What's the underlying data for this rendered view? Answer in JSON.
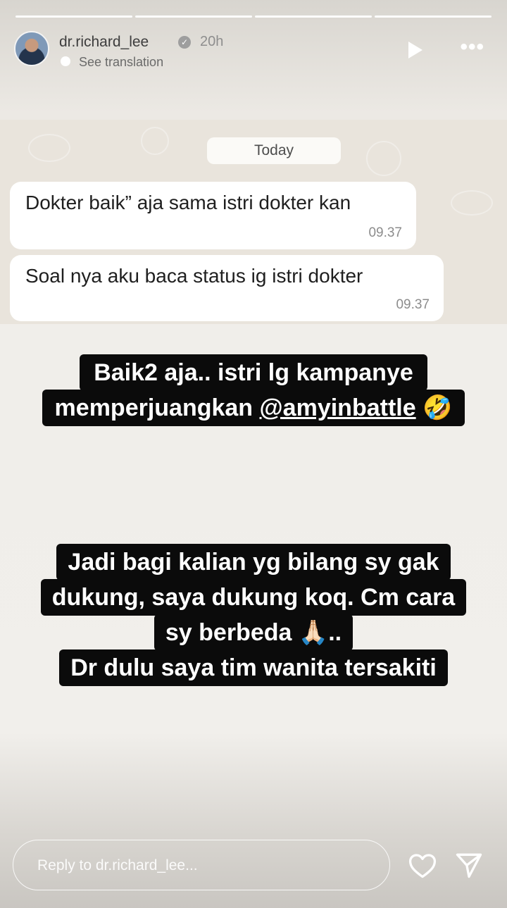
{
  "story": {
    "progress_segments": 4,
    "username": "dr.richard_lee",
    "verified_icon": "verified-badge-icon",
    "time_ago": "20h",
    "see_translation": "See translation"
  },
  "chat": {
    "date_label": "Today",
    "messages": [
      {
        "text": "Dokter baik” aja sama istri dokter kan",
        "time": "09.37"
      },
      {
        "text": "Soal nya aku baca status ig istri dokter",
        "time": "09.37"
      }
    ]
  },
  "caption1": {
    "line1": "Baik2 aja.. istri lg kampanye",
    "line2_prefix": "memperjuangkan ",
    "mention": "@amyinbattle",
    "emoji": "🤣"
  },
  "caption2": {
    "line1": "Jadi bagi kalian yg bilang sy gak",
    "line2": "dukung, saya dukung koq. Cm cara",
    "line3_text": "sy berbeda ",
    "line3_emoji": "🙏🏻",
    "line3_suffix": "..",
    "line4": "Dr dulu saya tim wanita tersakiti"
  },
  "footer": {
    "reply_placeholder": "Reply to dr.richard_lee..."
  }
}
